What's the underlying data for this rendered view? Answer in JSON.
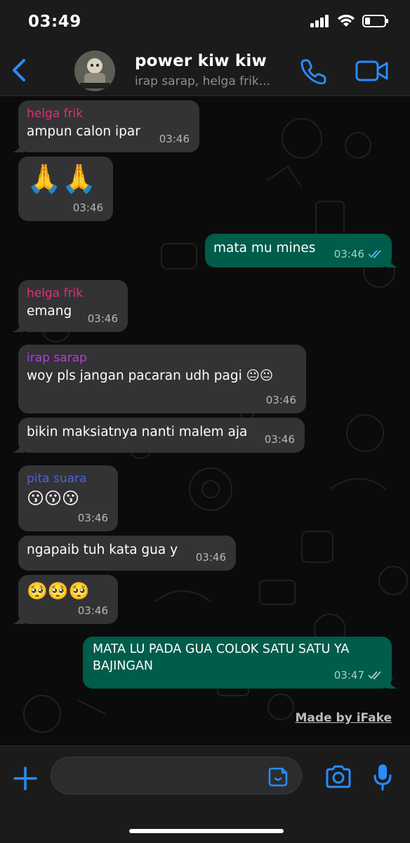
{
  "status_bar": {
    "time": "03:49"
  },
  "header": {
    "title": "power kiw kiw",
    "subtitle": "irap sarap, helga frik..."
  },
  "colors": {
    "accent": "#2a8cff",
    "outgoing": "#005c4b",
    "incoming": "#333335",
    "helga": "#e0306f",
    "irap": "#b13fd8",
    "pita": "#4b62d8"
  },
  "messages": [
    {
      "sender": "helga frik",
      "text": "ampun calon ipar",
      "time": "03:46"
    },
    {
      "text": "🙏🙏",
      "time": "03:46"
    },
    {
      "text": "mata mu mines",
      "time": "03:46"
    },
    {
      "sender": "helga frik",
      "text": "emang",
      "time": "03:46"
    },
    {
      "sender": "irap sarap",
      "text": "woy pls jangan pacaran udh pagi 😐😐",
      "time": "03:46"
    },
    {
      "text": "bikin maksiatnya nanti malem aja",
      "time": "03:46"
    },
    {
      "sender": "pita suara",
      "text": "😗😗😗",
      "time": "03:46"
    },
    {
      "text": "ngapaib tuh kata gua y",
      "time": "03:46"
    },
    {
      "text": "🥺🥺🥺",
      "time": "03:46"
    },
    {
      "text": "MATA LU PADA GUA COLOK SATU SATU YA BAJINGAN",
      "time": "03:47"
    }
  ],
  "watermark": "Made by iFake"
}
